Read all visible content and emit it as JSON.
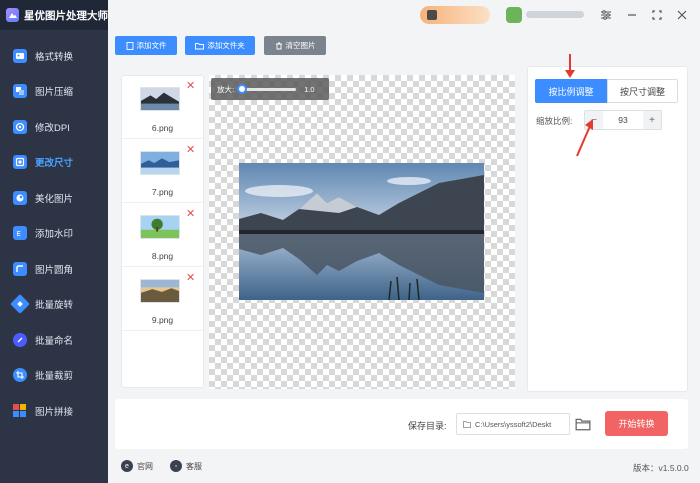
{
  "app": {
    "title": "星优图片处理大师"
  },
  "sidebar": {
    "items": [
      {
        "label": "格式转换",
        "icon": "format-convert-icon",
        "color": "#3c8dff"
      },
      {
        "label": "图片压缩",
        "icon": "compress-icon",
        "color": "#3c8dff"
      },
      {
        "label": "修改DPI",
        "icon": "dpi-icon",
        "color": "#3c8dff"
      },
      {
        "label": "更改尺寸",
        "icon": "resize-icon",
        "color": "#3c8dff",
        "active": true
      },
      {
        "label": "美化图片",
        "icon": "beautify-icon",
        "color": "#3c8dff"
      },
      {
        "label": "添加水印",
        "icon": "watermark-icon",
        "color": "#3c8dff"
      },
      {
        "label": "图片圆角",
        "icon": "round-corner-icon",
        "color": "#3c8dff"
      },
      {
        "label": "批量旋转",
        "icon": "rotate-icon",
        "color": "#3c8dff"
      },
      {
        "label": "批量命名",
        "icon": "rename-icon",
        "color": "#4b5cff"
      },
      {
        "label": "批量裁剪",
        "icon": "crop-icon",
        "color": "#3c8dff"
      },
      {
        "label": "图片拼接",
        "icon": "stitch-icon",
        "color": "#e84e4e"
      }
    ]
  },
  "toolbar": {
    "add_file": "添加文件",
    "add_folder": "添加文件夹",
    "clear": "清空图片"
  },
  "files": [
    {
      "name": "6.png",
      "thumb": "mountain-dark"
    },
    {
      "name": "7.png",
      "thumb": "mountain-blue"
    },
    {
      "name": "8.png",
      "thumb": "tree-field"
    },
    {
      "name": "9.png",
      "thumb": "sunset-hills"
    }
  ],
  "canvas": {
    "zoom_label": "放大:",
    "zoom_value": "1.0",
    "zoom_level": 0.0
  },
  "settings": {
    "tab_ratio": "按比例调整",
    "tab_size": "按尺寸调整",
    "ratio_label": "缩放比例:",
    "ratio_value": "93",
    "minus": "−",
    "plus": "+"
  },
  "bottom": {
    "save_label": "保存目录:",
    "save_path": "C:\\Users\\yssoft2\\Deskt",
    "start_button": "开始转换"
  },
  "footer": {
    "website": "官网",
    "support": "客服",
    "version": "版本：v1.5.0.0"
  },
  "colors": {
    "accent": "#3c8dff",
    "danger": "#f26464",
    "sidebar": "#2c3446"
  }
}
